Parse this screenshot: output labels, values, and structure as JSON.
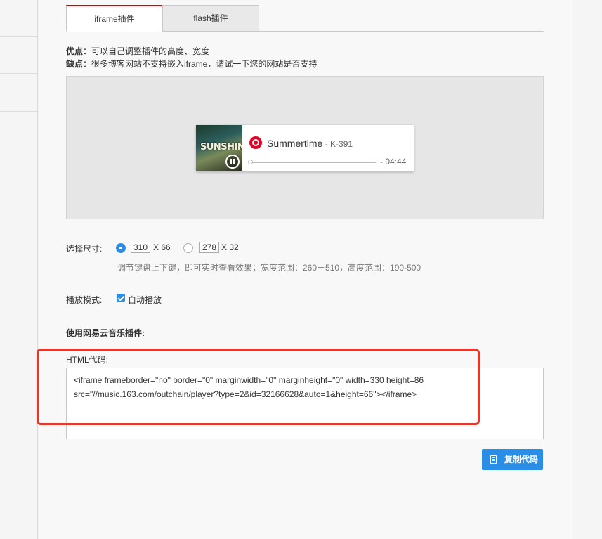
{
  "tabs": [
    {
      "label": "iframe插件",
      "active": true
    },
    {
      "label": "flash插件",
      "active": false
    }
  ],
  "info": {
    "pros_key": "优点",
    "pros_text": "：可以自己调整插件的高度、宽度",
    "cons_key": "缺点",
    "cons_text": "：很多博客网站不支持嵌入iframe，请试一下您的网站是否支持"
  },
  "player": {
    "cover_text": "SUNSHINE",
    "song_title": "Summertime",
    "artist": " - K-391",
    "time": "- 04:44",
    "progress": 0.0
  },
  "size": {
    "label": "选择尺寸:",
    "option1_value": "310",
    "option1_height": "X 66",
    "option2_value": "278",
    "option2_height": "X 32",
    "selected": 1,
    "hint": "调节键盘上下键，即可实时查看效果；宽度范围：260－510，高度范围：190-500"
  },
  "playmode": {
    "label": "播放模式:",
    "autoplay_label": "自动播放",
    "autoplay_checked": true
  },
  "plugin": {
    "heading": "使用网易云音乐插件:",
    "code_label": "HTML代码:",
    "code_line1": "<iframe frameborder=\"no\" border=\"0\" marginwidth=\"0\" marginheight=\"0\" width=330 height=86",
    "code_line2": "src=\"//music.163.com/outchain/player?type=2&id=32166628&auto=1&height=66\"></iframe>",
    "copy_button": "复制代码"
  },
  "colors": {
    "accent": "#2b8ee6",
    "tab_active_top": "#c20c0c",
    "highlight": "#e03a2e",
    "netease_red": "#e60026"
  }
}
